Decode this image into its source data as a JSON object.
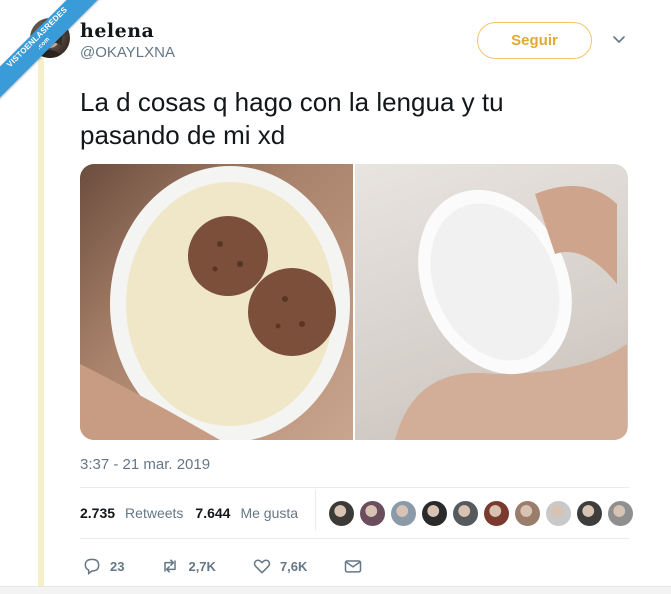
{
  "watermark": {
    "line1": "VISTOENLASREDES",
    "line2": ".com"
  },
  "user": {
    "display_name": "helena",
    "handle": "@OKAYLXNA"
  },
  "follow_label": "Seguir",
  "tweet": {
    "text": "La d cosas q hago con la lengua y tu pasando de mi xd"
  },
  "timestamp": "3:37 - 21 mar. 2019",
  "stats": {
    "retweets_count": "2.735",
    "retweets_label": "Retweets",
    "likes_count": "7.644",
    "likes_label": "Me gusta"
  },
  "likers": [
    "#3b3a38",
    "#6a4e5c",
    "#8a9aa8",
    "#2a2a2a",
    "#555a5f",
    "#7a3b2e",
    "#9a7d6b",
    "#c9c9c9",
    "#3d3d3d",
    "#8f8f8f"
  ],
  "actions": {
    "replies": "23",
    "retweets": "2,7K",
    "likes": "7,6K"
  },
  "colors": {
    "accent": "#e3a832",
    "ribbon": "#3a9bd9",
    "muted": "#657786"
  }
}
